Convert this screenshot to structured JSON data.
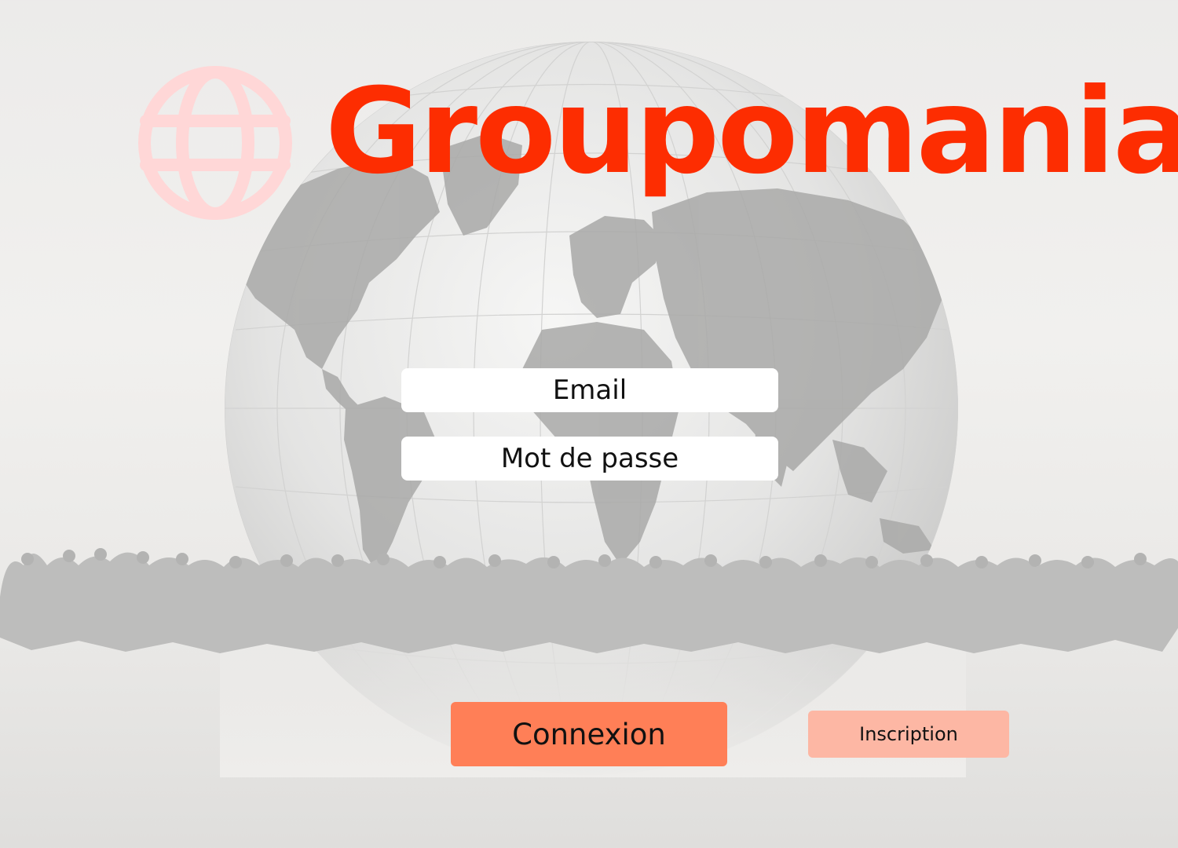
{
  "brand": {
    "name": "Groupomania",
    "logo_icon": "globe-icon",
    "primary_color": "#fd2d01",
    "logo_icon_color": "#ffd7d7"
  },
  "background": {
    "globe_icon": "world-globe-illustration",
    "crowd_icon": "crowd-silhouette-illustration"
  },
  "login_form": {
    "email_placeholder": "Email",
    "password_placeholder": "Mot de passe"
  },
  "actions": {
    "login_label": "Connexion",
    "login_color": "#ff7f57",
    "signup_label": "Inscription",
    "signup_color": "#fdb7a4"
  }
}
